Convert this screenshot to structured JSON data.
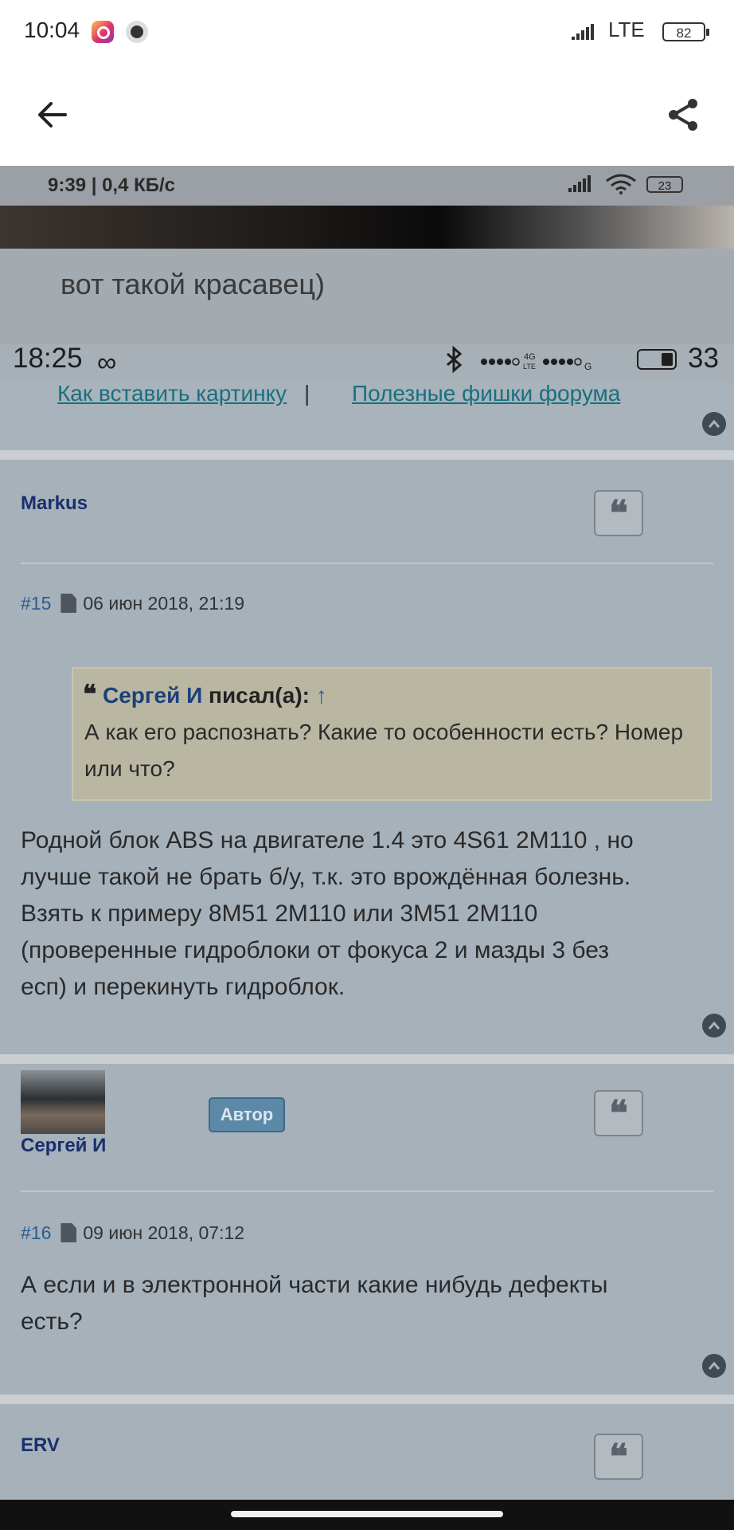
{
  "system_status": {
    "time": "10:04",
    "network": "LTE",
    "battery": "82"
  },
  "toolbar": {
    "back_icon": "arrow-left-icon",
    "share_icon": "share-icon"
  },
  "screenshot_status": {
    "time_speed": "9:39 | 0,4 КБ/с",
    "battery": "23"
  },
  "caption": "вот такой красавец)",
  "inner_status": {
    "time": "18:25",
    "loop": "∞",
    "signal": "4G LTE G",
    "battery_pct": "33"
  },
  "links": {
    "insert_image": "Как вставить картинку",
    "separator": "|",
    "forum_tips": "Полезные фишки форума"
  },
  "posts": [
    {
      "author": "Markus",
      "number": "#15",
      "date": "06 июн 2018, 21:19",
      "quote": {
        "author": "Сергей И",
        "wrote": "писал(а):",
        "arrow": "↑",
        "text": "А как его распознать? Какие то особенности есть? Номер или что?"
      },
      "body_lines": [
        "Родной блок ABS на двигателе 1.4 это 4S61 2M110 , но",
        "лучше такой не брать б/у, т.к. это врождённая болезнь.",
        "Взять к примеру 8M51 2M110 или 3M51 2M110",
        "(проверенные гидроблоки от фокуса 2 и мазды 3 без",
        "есп) и перекинуть гидроблок."
      ]
    },
    {
      "author": "Сергей И",
      "badge": "Автор",
      "number": "#16",
      "date": "09 июн 2018, 07:12",
      "body_lines": [
        "А если и в электронной части какие нибудь дефекты",
        "есть?"
      ]
    },
    {
      "author": "ERV"
    }
  ],
  "quote_glyph": "❝"
}
